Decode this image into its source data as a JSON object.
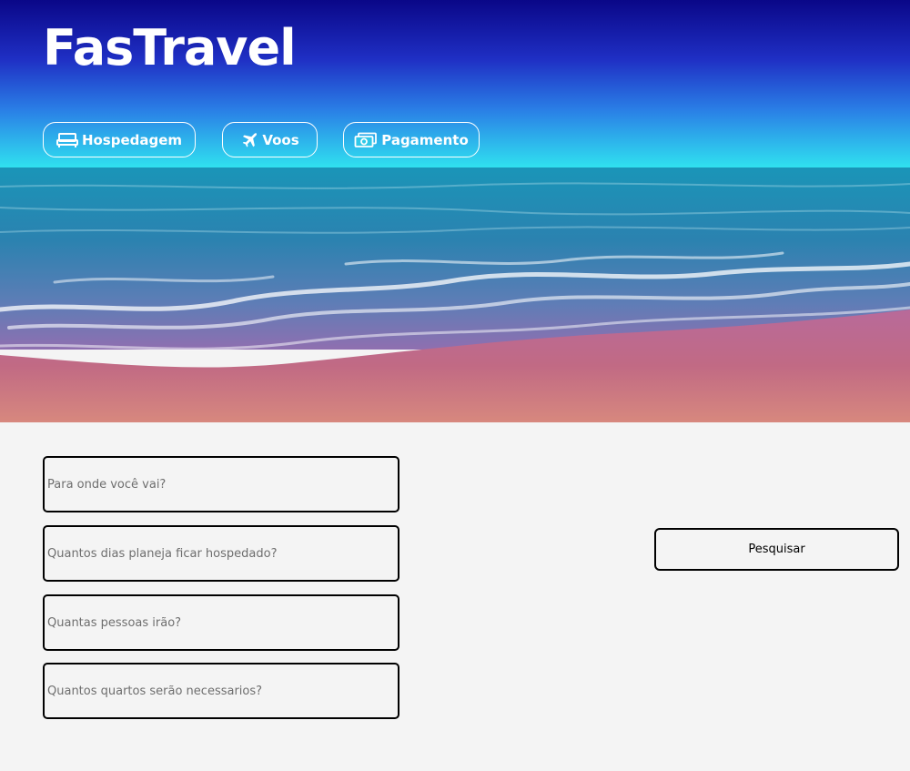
{
  "brand": {
    "title": "FasTravel"
  },
  "nav": {
    "hospedagem": {
      "label": "Hospedagem",
      "icon": "bed-icon"
    },
    "voos": {
      "label": "Voos",
      "icon": "airplane-icon"
    },
    "pagamento": {
      "label": "Pagamento",
      "icon": "money-icon"
    }
  },
  "form": {
    "destination_placeholder": "Para onde você vai?",
    "days_placeholder": "Quantos dias planeja ficar hospedado?",
    "people_placeholder": "Quantas pessoas irão?",
    "rooms_placeholder": "Quantos quartos serão necessarios?",
    "search_label": "Pesquisar"
  },
  "colors": {
    "header_top": "#0b0a8a",
    "header_bottom": "#2ee6f0",
    "page_bg": "#f4f4f4",
    "sand": "#c0607a"
  }
}
